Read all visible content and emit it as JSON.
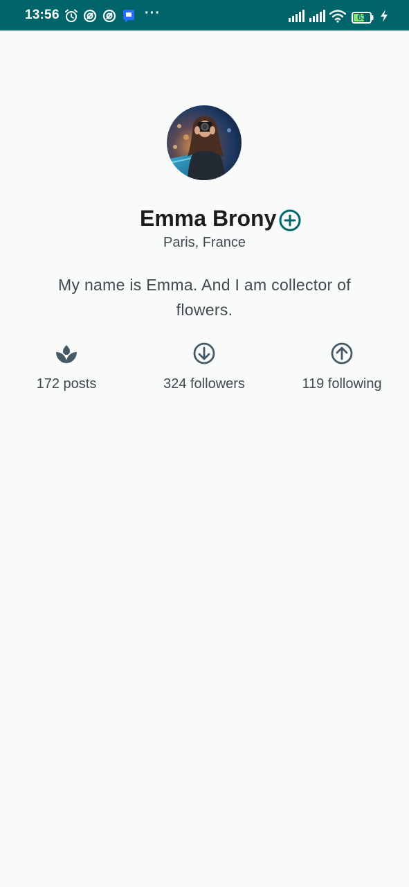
{
  "status_bar": {
    "time": "13:56",
    "battery": "63",
    "overflow": "···",
    "icons": [
      "alarm-icon",
      "app-notification-icon",
      "app-notification-icon",
      "message-icon",
      "signal-icon",
      "signal-icon",
      "wifi-icon",
      "battery-icon",
      "charging-icon"
    ]
  },
  "profile": {
    "name": "Emma Brony",
    "location": "Paris, France",
    "bio": "My name is Emma. And I am collector of flowers.",
    "avatar_icon": "avatar-photo"
  },
  "stats": [
    {
      "icon": "sprout-icon",
      "label": "172 posts"
    },
    {
      "icon": "arrow-down-circle-icon",
      "label": "324 followers"
    },
    {
      "icon": "arrow-up-circle-icon",
      "label": "119 following"
    }
  ],
  "colors": {
    "status_bar": "#00656a",
    "accent": "#00656a",
    "background": "#f9fbfb",
    "text_primary": "#1c1c1c",
    "text_secondary": "#3e4a4e",
    "icon": "#455a64"
  }
}
